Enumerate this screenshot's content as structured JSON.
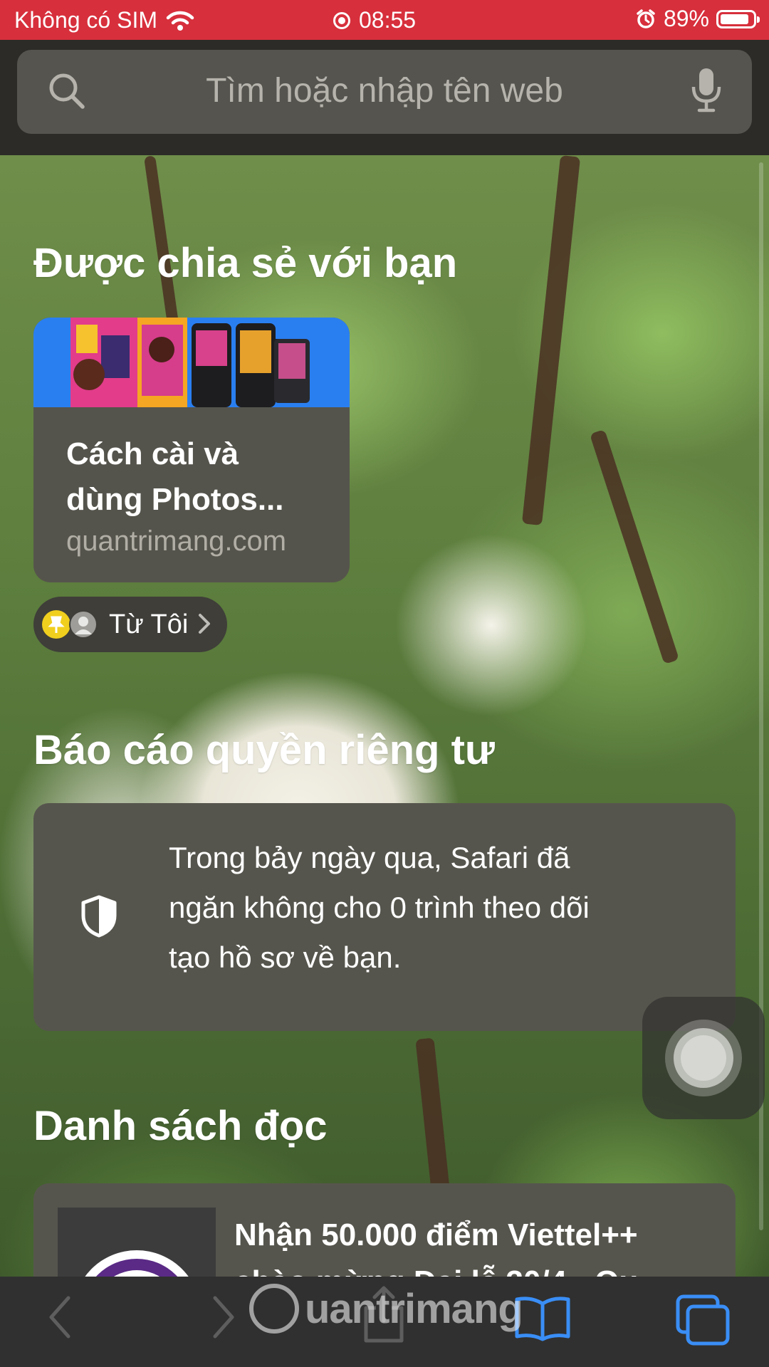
{
  "status_bar": {
    "carrier": "Không có SIM",
    "time": "08:55",
    "battery": "89%",
    "battery_level": 0.89
  },
  "search": {
    "placeholder": "Tìm hoặc nhập tên web"
  },
  "shared_with_you": {
    "heading": "Được chia sẻ với bạn",
    "card": {
      "title_line1": "Cách cài và",
      "title_line2": "dùng Photos...",
      "domain": "quantrimang.com"
    },
    "from": "Từ Tôi"
  },
  "privacy_report": {
    "heading": "Báo cáo quyền riêng tư",
    "text_line1": "Trong bảy ngày qua, Safari đã",
    "text_line2": "ngăn không cho 0 trình theo dõi",
    "text_line3": "tạo hồ sơ về bạn."
  },
  "reading_list": {
    "heading": "Danh sách đọc",
    "item": {
      "title_line1": "Nhận 50.000 điểm Viettel++",
      "title_line2": "chào mừng Đại lễ 30/4 - Qu..."
    }
  },
  "watermark": "uantrimang",
  "colors": {
    "status_bar": "#d72f3c",
    "toolbar_accent": "#3a8ef6",
    "card": "#55544c"
  },
  "icons": [
    "wifi-icon",
    "screen-record-icon",
    "alarm-icon",
    "battery-icon",
    "search-icon",
    "microphone-icon",
    "shield-icon",
    "chevron-right-icon",
    "back-icon",
    "forward-icon",
    "share-icon",
    "bookmarks-icon",
    "tabs-icon"
  ]
}
